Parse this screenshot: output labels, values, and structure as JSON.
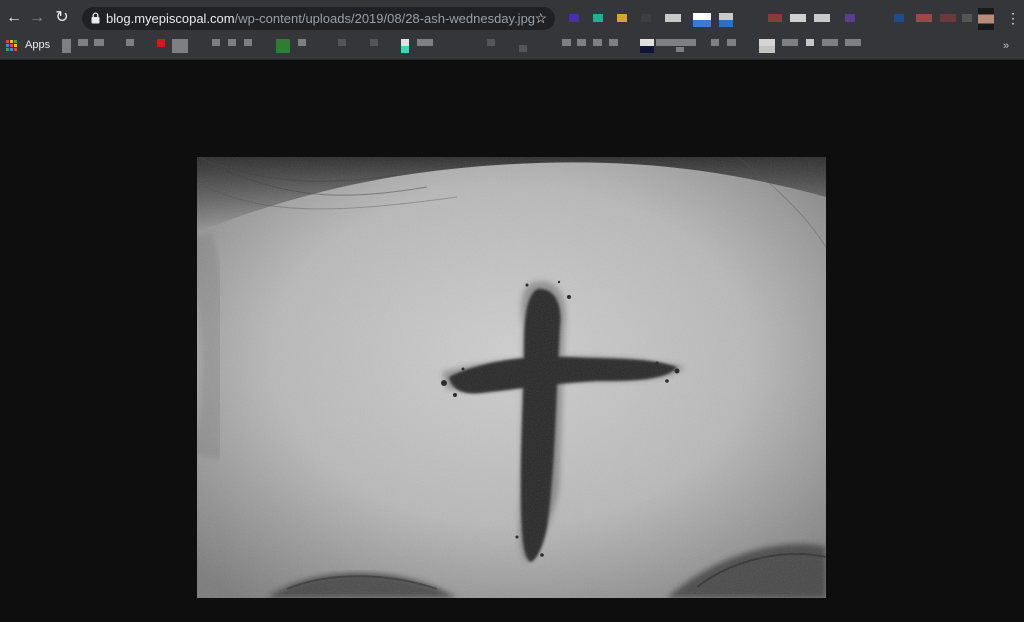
{
  "browser": {
    "url_host": "blog.myepiscopal.com",
    "url_path": "/wp-content/uploads/2019/08/28-ash-wednesday.jpg",
    "bookmarks_apps_label": "Apps",
    "extension_colors": [
      "#4b2fa6",
      "#19b394",
      "#d6a33a",
      "#3d3e42",
      "#c9c9c9",
      "#3a7bd5",
      "#8a3a3a",
      "#d0d0d0",
      "#5a3d8f",
      "#1f4b8a",
      "#9b4a4a",
      "#b88a7a"
    ]
  },
  "image": {
    "description_icon": "ash-cross-forehead-photo"
  }
}
